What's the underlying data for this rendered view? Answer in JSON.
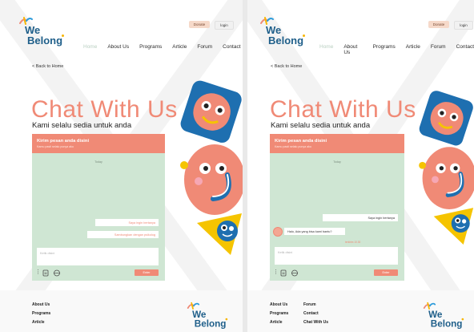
{
  "screens": [
    {
      "header": {
        "donate_label": "Donate",
        "login_label": "login"
      },
      "logo": {
        "line1": "We",
        "line2": "Belong"
      },
      "nav": [
        "Home",
        "About Us",
        "Programs",
        "Article",
        "Forum",
        "Contact"
      ],
      "back_label": "< Back to Home",
      "hero": {
        "title": "Chat With Us",
        "subtitle": "Kami selalu sedia untuk anda"
      },
      "chat": {
        "header_title": "Kirim pesan anda disini",
        "header_sub": "Kamu pasti selalu punya aku",
        "date_label": "Today",
        "messages": [
          {
            "from": "user",
            "text": "Saya ingin bertanya"
          },
          {
            "from": "user",
            "text": "Sambungkan dengan psikolog"
          }
        ],
        "input_placeholder": "Ketik disini",
        "send_label": "Enter"
      },
      "footer": {
        "links": [
          "About Us",
          "Programs",
          "Article"
        ]
      }
    },
    {
      "header": {
        "donate_label": "Donate",
        "login_label": "login"
      },
      "logo": {
        "line1": "We",
        "line2": "Belong"
      },
      "nav": [
        "Home",
        "About Us",
        "Programs",
        "Article",
        "Forum",
        "Contact"
      ],
      "back_label": "< Back to Home",
      "hero": {
        "title": "Chat With Us",
        "subtitle": "Kami selalu sedia untuk anda"
      },
      "chat": {
        "header_title": "Kirim pesan anda disini",
        "header_sub": "Kamu pasti selalu punya aku",
        "date_label": "Today",
        "messages": [
          {
            "from": "user",
            "text": "Saya ingin bertanya"
          },
          {
            "from": "agent",
            "text": "Halo, Ada yang bisa kami bantu?"
          }
        ],
        "delivered_label": "terkirim 10.30",
        "input_placeholder": "Ketik disini",
        "send_label": "Enter"
      },
      "footer": {
        "links": [
          "About Us",
          "Programs",
          "Article",
          "Forum",
          "Contact",
          "Chat With Us"
        ]
      }
    }
  ],
  "colors": {
    "accent": "#f08a76",
    "chat_bg": "#cfe6d3",
    "brand_blue": "#1f5f8a",
    "logo_yellow": "#f7b500",
    "deco_blue": "#1e6fb0",
    "deco_yellow": "#f5c400"
  },
  "icons": [
    "we-belong-logo-mark",
    "more-vertical-icon",
    "attachment-icon",
    "emoji-icon"
  ]
}
